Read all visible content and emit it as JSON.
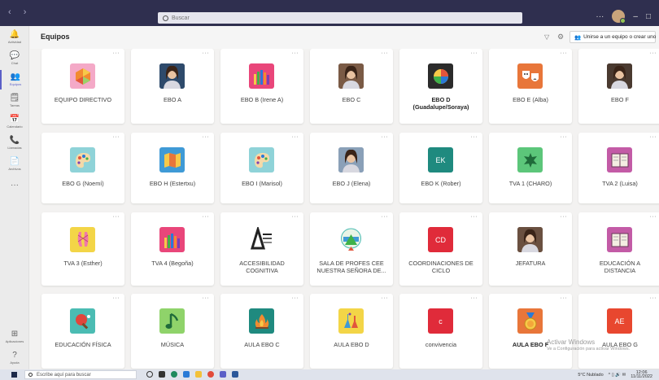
{
  "titlebar": {
    "nav": "‹ ›",
    "search_placeholder": "Buscar",
    "more": "···",
    "minimize": "–",
    "maximize": "□"
  },
  "rail": {
    "items": [
      {
        "label": "Actividad",
        "icon": "bell-icon",
        "glyph": "🔔"
      },
      {
        "label": "Chat",
        "icon": "chat-icon",
        "glyph": "💬"
      },
      {
        "label": "Equipos",
        "icon": "teams-icon",
        "glyph": "👥"
      },
      {
        "label": "Tareas",
        "icon": "tasks-icon",
        "glyph": "🗒"
      },
      {
        "label": "Calendario",
        "icon": "calendar-icon",
        "glyph": "📅"
      },
      {
        "label": "Llamadas",
        "icon": "phone-icon",
        "glyph": "📞"
      },
      {
        "label": "Archivos",
        "icon": "file-icon",
        "glyph": "📄"
      },
      {
        "label": "",
        "icon": "more-icon",
        "glyph": "···"
      }
    ],
    "bottom": [
      {
        "label": "Aplicaciones",
        "icon": "apps-icon",
        "glyph": "⊞"
      },
      {
        "label": "Ayuda",
        "icon": "help-icon",
        "glyph": "?"
      }
    ]
  },
  "header": {
    "title": "Equipos",
    "join_button": "Unirse a un equipo o crear uno"
  },
  "teams": [
    {
      "name": "EQUIPO DIRECTIVO",
      "kind": "hexagon",
      "bg": "#f4a9c7"
    },
    {
      "name": "EBO A",
      "kind": "photo",
      "bg": "#2e4a6b"
    },
    {
      "name": "EBO B (Irene A)",
      "kind": "crayons",
      "bg": "#e9467a"
    },
    {
      "name": "EBO C",
      "kind": "photo",
      "bg": "#7a5a45"
    },
    {
      "name": "EBO D\n(Guadalupe/Soraya)",
      "kind": "wheel",
      "bg": "#2b2b2b",
      "bold": true
    },
    {
      "name": "EBO E (Alba)",
      "kind": "masks",
      "bg": "#e8763a"
    },
    {
      "name": "EBO F",
      "kind": "photo",
      "bg": "#4a3a30"
    },
    {
      "name": "EBO G (Noemí)",
      "kind": "palette",
      "bg": "#8fd3d8"
    },
    {
      "name": "EBO H (Estertxu)",
      "kind": "map",
      "bg": "#3f9ad6"
    },
    {
      "name": "EBO I (Marisol)",
      "kind": "palette",
      "bg": "#8fd3d8"
    },
    {
      "name": "EBO J (Elena)",
      "kind": "photo",
      "bg": "#8aa0b8"
    },
    {
      "name": "EBO K (Rober)",
      "kind": "initials",
      "bg": "#1f8a7f",
      "initials": "EK"
    },
    {
      "name": "TVA 1 (CHARO)",
      "kind": "leaf",
      "bg": "#5cc67a"
    },
    {
      "name": "TVA 2 (Luisa)",
      "kind": "book",
      "bg": "#c35ba6"
    },
    {
      "name": "TVA 3 (Esther)",
      "kind": "ballet",
      "bg": "#f3d547"
    },
    {
      "name": "TVA 4 (Begoña)",
      "kind": "crayons",
      "bg": "#e9467a"
    },
    {
      "name": "ACCESIBILIDAD\nCOGNITIVA",
      "kind": "logo",
      "bg": "#ffffff"
    },
    {
      "name": "SALA DE PROFES CEE\nNUESTRA SEÑORA DE...",
      "kind": "badge",
      "bg": "#ffffff"
    },
    {
      "name": "COORDINACIONES DE\nCICLO",
      "kind": "initials",
      "bg": "#e02b3a",
      "initials": "CD"
    },
    {
      "name": "JEFATURA",
      "kind": "photo",
      "bg": "#6a5040"
    },
    {
      "name": "EDUCACIÓN A\nDISTANCIA",
      "kind": "book",
      "bg": "#c35ba6"
    },
    {
      "name": "EDUCACIÓN FÍSICA",
      "kind": "pingpong",
      "bg": "#4bbcb3"
    },
    {
      "name": "MÚSICA",
      "kind": "note",
      "bg": "#8fd36a"
    },
    {
      "name": "AULA EBO C",
      "kind": "fire",
      "bg": "#1f8a7f"
    },
    {
      "name": "AULA EBO D",
      "kind": "lab",
      "bg": "#f3d547"
    },
    {
      "name": "convivencia",
      "kind": "initials",
      "bg": "#e02b3a",
      "initials": "c"
    },
    {
      "name": "AULA EBO F",
      "kind": "medal",
      "bg": "#e8763a",
      "bold": true
    },
    {
      "name": "AULA EBO G",
      "kind": "initials",
      "bg": "#e8472f",
      "initials": "AE"
    }
  ],
  "watermark": {
    "line1": "Activar Windows",
    "line2": "Ve a Configuración para activar Windows."
  },
  "taskbar": {
    "search_placeholder": "Escribe aquí para buscar",
    "weather": "5°C Nublado",
    "time": "12:06",
    "date": "11/11/2022"
  }
}
